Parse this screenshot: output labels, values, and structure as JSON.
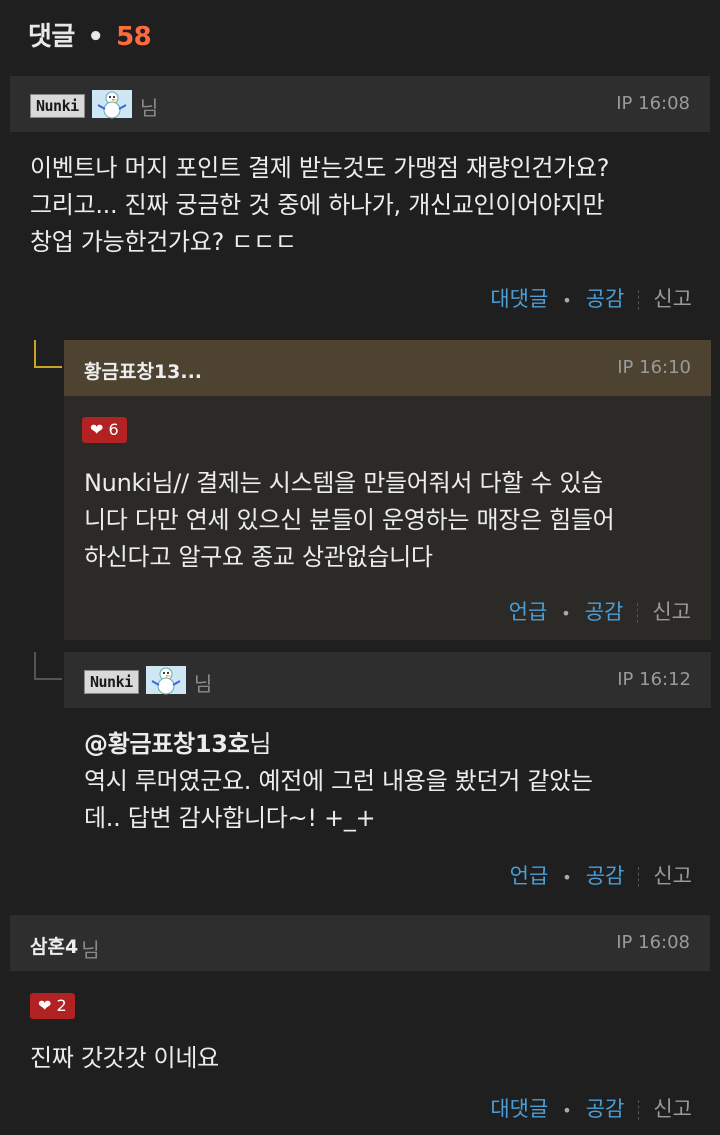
{
  "header": {
    "label": "댓글",
    "bullet": "•",
    "count": "58"
  },
  "comments": [
    {
      "nick_badge": "Nunki",
      "nim": "님",
      "ip": "IP  16:08",
      "lines": [
        "이벤트나 머지 포인트 결제 받는것도 가맹점 재량인건가요?",
        "그리고... 진짜 궁금한 것 중에 하나가, 개신교인이어야지만",
        "창업 가능한건가요? ㄷㄷㄷ"
      ],
      "actions": {
        "reply": "대댓글",
        "like": "공감",
        "report": "신고"
      }
    },
    {
      "name": "황금표창13...",
      "ip": "IP  16:10",
      "likes": "6",
      "lines": [
        "Nunki님// 결제는 시스템을 만들어줘서 다할 수 있습",
        "니다 다만 연세 있으신 분들이 운영하는 매장은 힘들어",
        "하신다고 알구요 종교 상관없습니다"
      ],
      "actions": {
        "mention": "언급",
        "like": "공감",
        "report": "신고"
      }
    },
    {
      "nick_badge": "Nunki",
      "nim": "님",
      "ip": "IP  16:12",
      "mention_line": "@황금표창13호",
      "mention_suffix": "님",
      "lines": [
        "역시 루머였군요. 예전에 그런 내용을 봤던거 같았는",
        "데.. 답변 감사합니다~! +_+"
      ],
      "actions": {
        "mention": "언급",
        "like": "공감",
        "report": "신고"
      }
    },
    {
      "name": "삼혼4",
      "nim": "님",
      "ip": "IP  16:08",
      "likes": "2",
      "lines": [
        "진짜 갓갓갓 이네요"
      ],
      "actions": {
        "reply": "대댓글",
        "like": "공감",
        "report": "신고"
      }
    }
  ],
  "colors": {
    "accent": "#ff6b3d",
    "link": "#4a9fd8",
    "best_reply": "#4e4330",
    "heart": "#b22222"
  },
  "icons": {
    "like_badge": "heart-icon",
    "avatar": "snowman-icon"
  }
}
